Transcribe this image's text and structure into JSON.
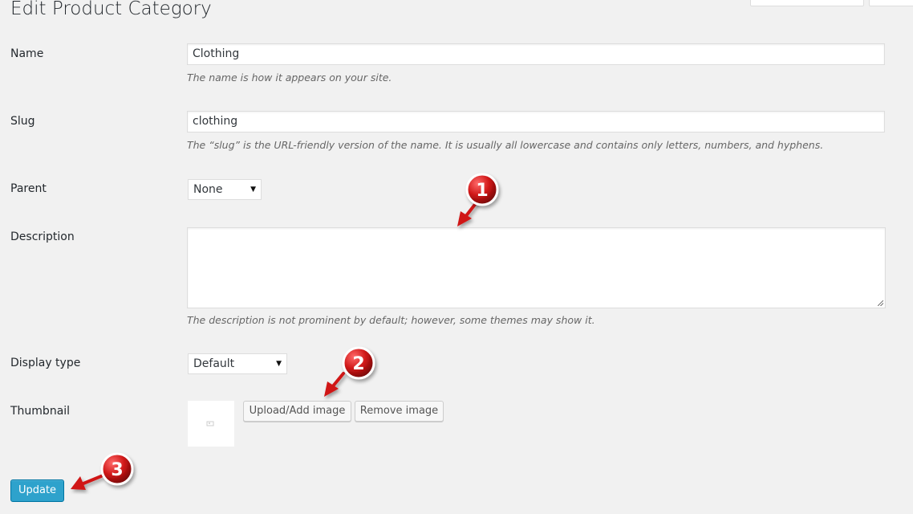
{
  "page": {
    "title": "Edit Product Category"
  },
  "fields": {
    "name": {
      "label": "Name",
      "value": "Clothing",
      "help": "The name is how it appears on your site."
    },
    "slug": {
      "label": "Slug",
      "value": "clothing",
      "help": "The “slug” is the URL-friendly version of the name. It is usually all lowercase and contains only letters, numbers, and hyphens."
    },
    "parent": {
      "label": "Parent",
      "selected": "None"
    },
    "description": {
      "label": "Description",
      "value": "",
      "help": "The description is not prominent by default; however, some themes may show it."
    },
    "display_type": {
      "label": "Display type",
      "selected": "Default"
    },
    "thumbnail": {
      "label": "Thumbnail",
      "upload_label": "Upload/Add image",
      "remove_label": "Remove image"
    }
  },
  "actions": {
    "update_label": "Update"
  },
  "annotations": {
    "marker_1": "1",
    "marker_2": "2",
    "marker_3": "3",
    "color": "#d01818"
  },
  "colors": {
    "primary_button": "#2ea2cc",
    "background": "#f1f1f1"
  }
}
